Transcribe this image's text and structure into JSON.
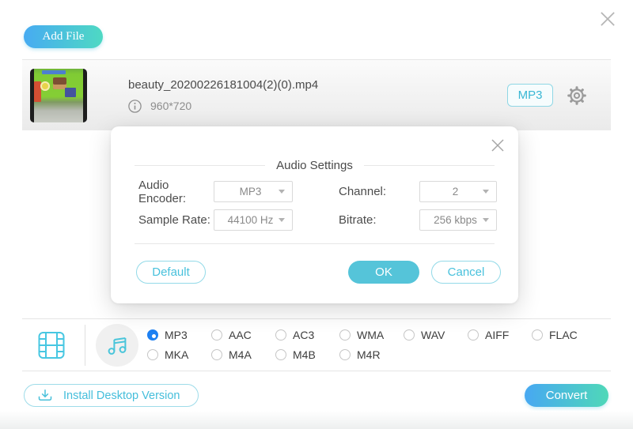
{
  "toolbar": {
    "add_file_label": "Add File"
  },
  "file_item": {
    "name": "beauty_20200226181004(2)(0).mp4",
    "resolution": "960*720",
    "format_chip": "MP3"
  },
  "audio_settings": {
    "title": "Audio Settings",
    "audio_encoder_label": "Audio Encoder:",
    "audio_encoder_value": "MP3",
    "channel_label": "Channel:",
    "channel_value": "2",
    "sample_rate_label": "Sample Rate:",
    "sample_rate_value": "44100 Hz",
    "bitrate_label": "Bitrate:",
    "bitrate_value": "256 kbps",
    "default_button": "Default",
    "ok_button": "OK",
    "cancel_button": "Cancel"
  },
  "formats": {
    "selected": "MP3",
    "row1": [
      "MP3",
      "AAC",
      "AC3",
      "WMA",
      "WAV",
      "AIFF",
      "FLAC"
    ],
    "row2": [
      "MKA",
      "M4A",
      "M4B",
      "M4R"
    ]
  },
  "footer": {
    "install_label": "Install Desktop Version",
    "convert_label": "Convert"
  },
  "colors": {
    "accent_teal": "#4ec3d9",
    "selected_radio_blue": "#1d80f2",
    "button_gradient_start": "#47abf2",
    "button_gradient_end": "#4ed9c3",
    "ok_button_fill": "#55c4d9"
  },
  "icons": {
    "window_close": "close-x",
    "modal_close": "close-x",
    "file_info": "info-circle",
    "settings": "gear",
    "video_category": "film-strip",
    "audio_category": "music-note",
    "install": "download-arrow",
    "dropdown": "caret-down"
  }
}
